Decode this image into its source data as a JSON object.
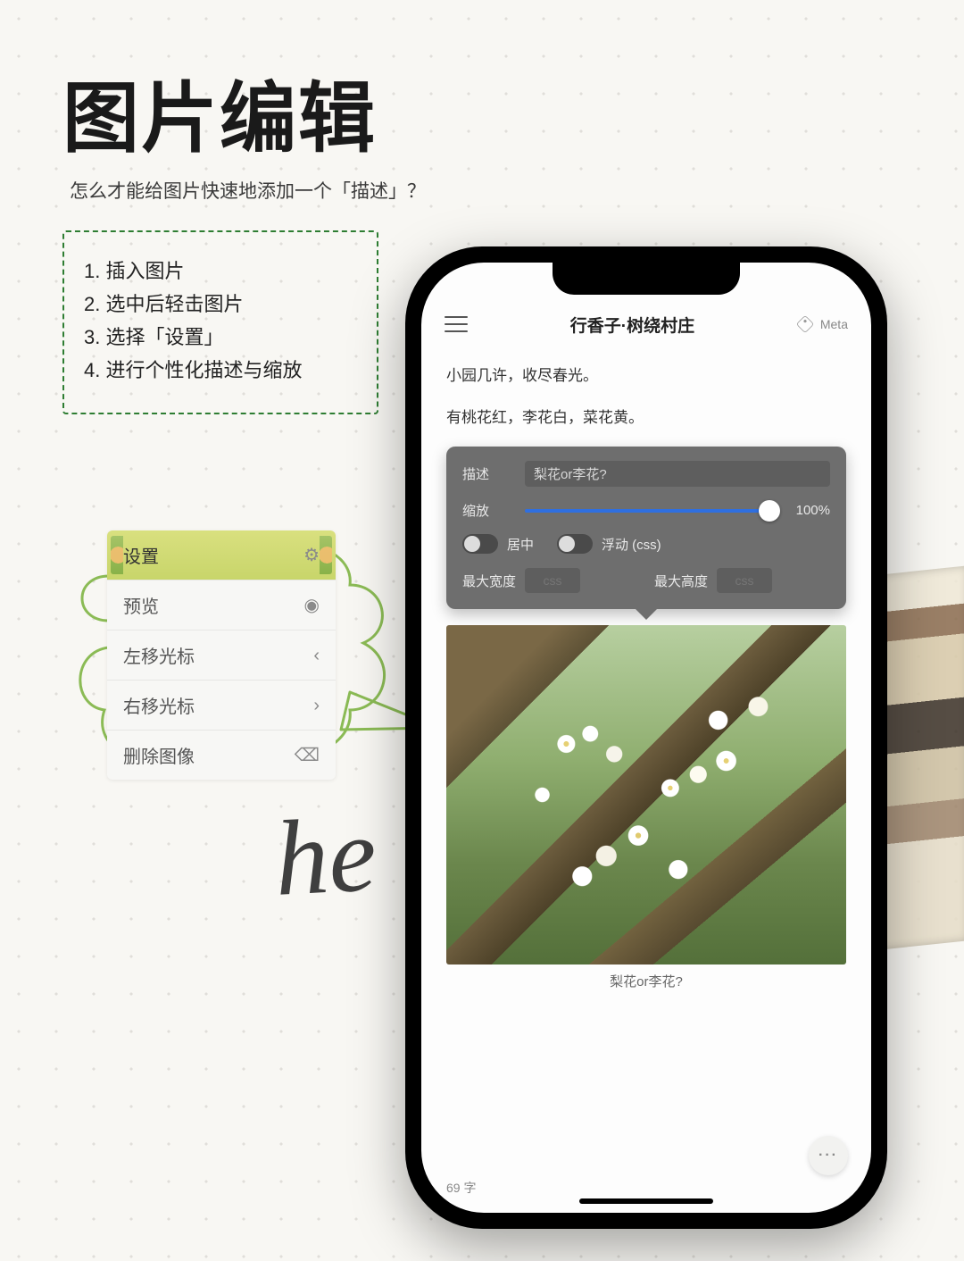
{
  "page": {
    "title": "图片编辑",
    "subtitle": "怎么才能给图片快速地添加一个「描述」？"
  },
  "steps": [
    "插入图片",
    "选中后轻击图片",
    "选择「设置」",
    "进行个性化描述与缩放"
  ],
  "context_menu": {
    "items": [
      {
        "label": "设置",
        "icon": "⚙",
        "selected": true
      },
      {
        "label": "预览",
        "icon": "◉"
      },
      {
        "label": "左移光标",
        "icon": "‹"
      },
      {
        "label": "右移光标",
        "icon": "›"
      },
      {
        "label": "删除图像",
        "icon": "⌫"
      }
    ]
  },
  "handwriting": "he",
  "phone": {
    "header": {
      "title": "行香子·树绕村庄",
      "meta_label": "Meta"
    },
    "body": {
      "poem_lines": [
        "小园几许，收尽春光。",
        "有桃花红，李花白，菜花黄。"
      ]
    },
    "popover": {
      "desc_label": "描述",
      "desc_value": "梨花or李花?",
      "zoom_label": "缩放",
      "zoom_value": "100%",
      "center_label": "居中",
      "float_label": "浮动 (css)",
      "max_w_label": "最大宽度",
      "max_w_placeholder": "css",
      "max_h_label": "最大高度",
      "max_h_placeholder": "css"
    },
    "image_caption": "梨花or李花?",
    "footer": {
      "word_count": "69 字",
      "fab": "···"
    }
  }
}
